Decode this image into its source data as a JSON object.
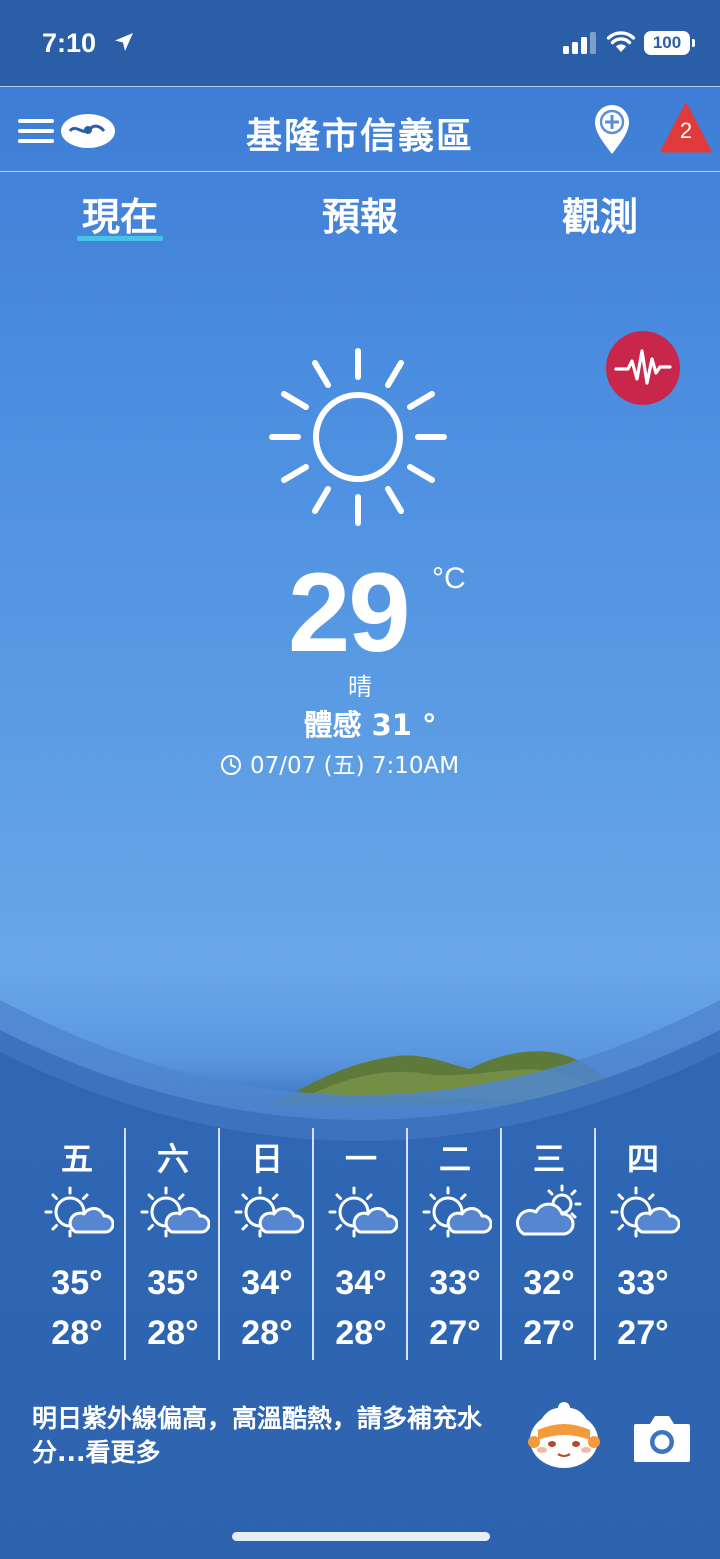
{
  "status_bar": {
    "time": "7:10",
    "battery": "100"
  },
  "header": {
    "title": "基隆市信義區",
    "alert_count": "2"
  },
  "tabs": [
    {
      "label": "現在",
      "active": true
    },
    {
      "label": "預報",
      "active": false
    },
    {
      "label": "觀測",
      "active": false
    }
  ],
  "current": {
    "icon": "sun-icon",
    "temperature": "29",
    "unit": "°C",
    "condition": "晴",
    "feels_like": "體感 31 °",
    "observed_time": "07/07 (五) 7:10AM"
  },
  "forecast": [
    {
      "day": "五",
      "icon": "sun-cloud-icon",
      "high": "35°",
      "low": "28°"
    },
    {
      "day": "六",
      "icon": "sun-cloud-icon",
      "high": "35°",
      "low": "28°"
    },
    {
      "day": "日",
      "icon": "sun-cloud-icon",
      "high": "34°",
      "low": "28°"
    },
    {
      "day": "一",
      "icon": "sun-cloud-icon",
      "high": "34°",
      "low": "28°"
    },
    {
      "day": "二",
      "icon": "sun-cloud-icon",
      "high": "33°",
      "low": "27°"
    },
    {
      "day": "三",
      "icon": "cloud-sun-icon",
      "high": "32°",
      "low": "27°"
    },
    {
      "day": "四",
      "icon": "sun-cloud-icon",
      "high": "33°",
      "low": "27°"
    }
  ],
  "tip": {
    "text": "明日紫外線偏高，高溫酷熱，請多補充水分...看更多"
  },
  "colors": {
    "tab_underline": "#46c4e6",
    "alert_red": "#e03a3a",
    "quake_button": "#c8264a",
    "status_bar_bg": "#2a5fa8"
  }
}
